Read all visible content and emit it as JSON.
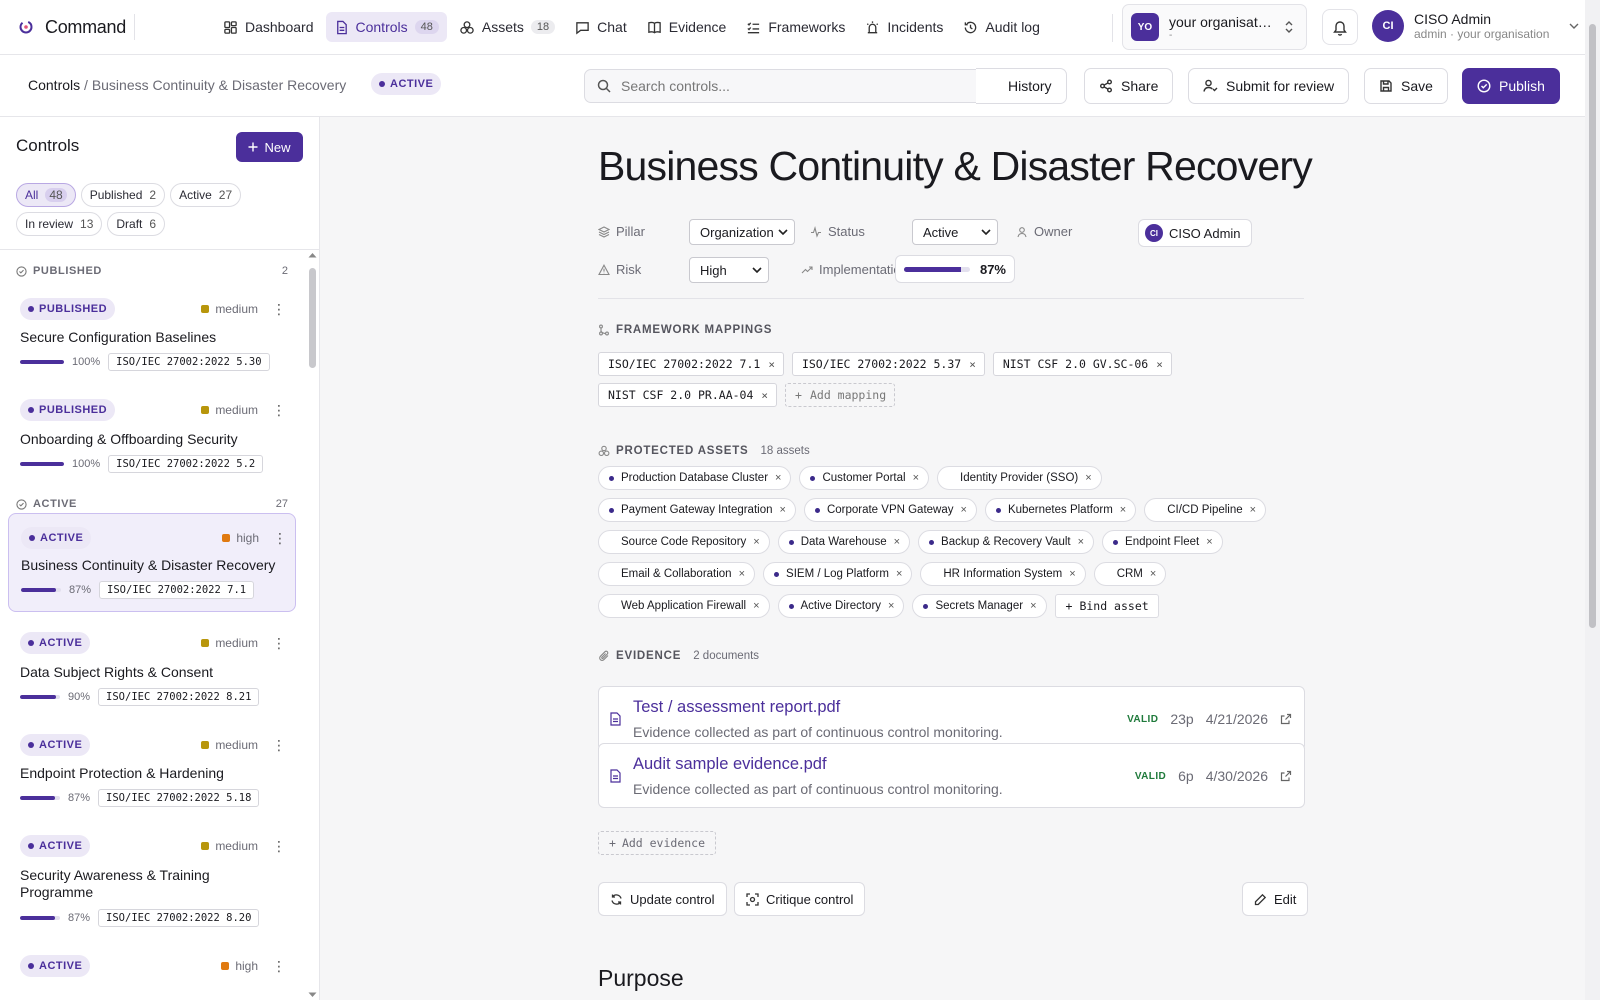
{
  "app": {
    "name": "Command",
    "accent": "#4b2f9b"
  },
  "nav": {
    "items": [
      {
        "label": "Dashboard",
        "icon": "dashboard-icon"
      },
      {
        "label": "Controls",
        "icon": "document-icon",
        "badge": "48",
        "active": true
      },
      {
        "label": "Assets",
        "icon": "assets-icon",
        "badge": "18"
      },
      {
        "label": "Chat",
        "icon": "chat-icon"
      },
      {
        "label": "Evidence",
        "icon": "book-icon"
      },
      {
        "label": "Frameworks",
        "icon": "list-icon"
      },
      {
        "label": "Incidents",
        "icon": "siren-icon"
      },
      {
        "label": "Audit log",
        "icon": "history-icon"
      }
    ]
  },
  "org": {
    "initials": "YO",
    "name": "your organisation",
    "sub": "-"
  },
  "user": {
    "initials": "CI",
    "name": "CISO Admin",
    "sub": "admin · your organisation"
  },
  "header": {
    "breadcrumb_root": "Controls",
    "breadcrumb_sep": " / ",
    "breadcrumb_current": "Business Continuity & Disaster Recovery",
    "status": "ACTIVE",
    "search_placeholder": "Search controls...",
    "history_label": "History",
    "share_label": "Share",
    "submit_label": "Submit for review",
    "save_label": "Save",
    "publish_label": "Publish"
  },
  "sidebar": {
    "title": "Controls",
    "new_label": "New",
    "filters": [
      {
        "label": "All",
        "count": "48",
        "active": true
      },
      {
        "label": "Published",
        "count": "2"
      },
      {
        "label": "Active",
        "count": "27"
      },
      {
        "label": "In review",
        "count": "13"
      },
      {
        "label": "Draft",
        "count": "6"
      }
    ],
    "sections": [
      {
        "label": "PUBLISHED",
        "count": "2"
      },
      {
        "label": "ACTIVE",
        "count": "27"
      }
    ],
    "cards": [
      {
        "status": "PUBLISHED",
        "severity": "medium",
        "title": "Secure Configuration Baselines",
        "progress": 100,
        "progress_label": "100%",
        "ref": "ISO/IEC 27002:2022 5.30"
      },
      {
        "status": "PUBLISHED",
        "severity": "medium",
        "title": "Onboarding & Offboarding Security",
        "progress": 100,
        "progress_label": "100%",
        "ref": "ISO/IEC 27002:2022 5.2"
      },
      {
        "status": "ACTIVE",
        "severity": "high",
        "title": "Business Continuity & Disaster Recovery",
        "progress": 87,
        "progress_label": "87%",
        "ref": "ISO/IEC 27002:2022 7.1",
        "selected": true
      },
      {
        "status": "ACTIVE",
        "severity": "medium",
        "title": "Data Subject Rights & Consent",
        "progress": 90,
        "progress_label": "90%",
        "ref": "ISO/IEC 27002:2022 8.21"
      },
      {
        "status": "ACTIVE",
        "severity": "medium",
        "title": "Endpoint Protection & Hardening",
        "progress": 87,
        "progress_label": "87%",
        "ref": "ISO/IEC 27002:2022 5.18"
      },
      {
        "status": "ACTIVE",
        "severity": "medium",
        "title": "Security Awareness & Training Programme",
        "progress": 87,
        "progress_label": "87%",
        "ref": "ISO/IEC 27002:2022 8.20"
      },
      {
        "status": "ACTIVE",
        "severity": "high"
      }
    ],
    "severity_colors": {
      "medium": "#b8960c",
      "high": "#e07a10"
    }
  },
  "control": {
    "title": "Business Continuity & Disaster Recovery",
    "pillar_label": "Pillar",
    "pillar_value": "Organization",
    "status_label": "Status",
    "status_value": "Active",
    "owner_label": "Owner",
    "owner_initials": "CI",
    "owner_value": "CISO Admin",
    "risk_label": "Risk",
    "risk_value": "High",
    "implementation_label": "Implementation",
    "implementation_value": 87,
    "implementation_text": "87%"
  },
  "mappings": {
    "title": "FRAMEWORK MAPPINGS",
    "items": [
      "ISO/IEC 27002:2022 7.1",
      "ISO/IEC 27002:2022 5.37",
      "NIST CSF 2.0 GV.SC-06",
      "NIST CSF 2.0 PR.AA-04"
    ],
    "add_label": "Add mapping"
  },
  "assets": {
    "title": "PROTECTED ASSETS",
    "meta": "18 assets",
    "items": [
      {
        "label": "Production Database Cluster",
        "dot": true
      },
      {
        "label": "Customer Portal",
        "dot": true
      },
      {
        "label": "Identity Provider (SSO)",
        "dot": false
      },
      {
        "label": "Payment Gateway Integration",
        "dot": true
      },
      {
        "label": "Corporate VPN Gateway",
        "dot": true
      },
      {
        "label": "Kubernetes Platform",
        "dot": true
      },
      {
        "label": "CI/CD Pipeline",
        "dot": false
      },
      {
        "label": "Source Code Repository",
        "dot": false
      },
      {
        "label": "Data Warehouse",
        "dot": true
      },
      {
        "label": "Backup & Recovery Vault",
        "dot": true
      },
      {
        "label": "Endpoint Fleet",
        "dot": true
      },
      {
        "label": "Email & Collaboration",
        "dot": false
      },
      {
        "label": "SIEM / Log Platform",
        "dot": true
      },
      {
        "label": "HR Information System",
        "dot": false
      },
      {
        "label": "CRM",
        "dot": false
      },
      {
        "label": "Web Application Firewall",
        "dot": false
      },
      {
        "label": "Active Directory",
        "dot": true
      },
      {
        "label": "Secrets Manager",
        "dot": true
      }
    ],
    "add_label": "Bind asset"
  },
  "evidence": {
    "title": "EVIDENCE",
    "meta": "2 documents",
    "items": [
      {
        "title": "Test / assessment report.pdf",
        "desc": "Evidence collected as part of continuous control monitoring.",
        "validity": "VALID",
        "pages": "23p",
        "date": "4/21/2026"
      },
      {
        "title": "Audit sample evidence.pdf",
        "desc": "Evidence collected as part of continuous control monitoring.",
        "validity": "VALID",
        "pages": "6p",
        "date": "4/30/2026"
      }
    ],
    "add_label": "Add evidence"
  },
  "actions": {
    "update_label": "Update control",
    "critique_label": "Critique control",
    "edit_label": "Edit"
  },
  "purpose": {
    "heading": "Purpose"
  }
}
